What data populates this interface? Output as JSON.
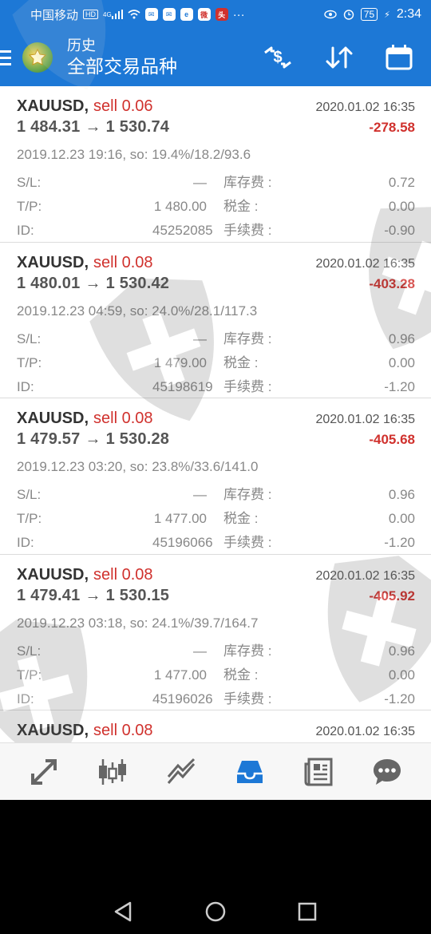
{
  "status_bar": {
    "carrier": "中国移动",
    "network": "HD",
    "signal": "4G",
    "battery": "75",
    "time": "2:34",
    "more": "···"
  },
  "app_bar": {
    "title": "历史",
    "subtitle": "全部交易品种"
  },
  "labels": {
    "sl": "S/L:",
    "tp": "T/P:",
    "id": "ID:",
    "swap": "库存费 :",
    "tax": "税金 :",
    "fee": "手续费 :",
    "arrow": "→"
  },
  "trades": [
    {
      "symbol": "XAUUSD",
      "sep": ",",
      "direction": "sell 0.06",
      "close_time": "2020.01.02 16:35",
      "open_price": "1 484.31",
      "close_price": "1 530.74",
      "profit": "-278.58",
      "open_info": "2019.12.23 19:16, so: 19.4%/18.2/93.6",
      "sl": "—",
      "tp": "1 480.00",
      "id": "45252085",
      "swap": "0.72",
      "tax": "0.00",
      "fee": "-0.90"
    },
    {
      "symbol": "XAUUSD",
      "sep": ",",
      "direction": "sell 0.08",
      "close_time": "2020.01.02 16:35",
      "open_price": "1 480.01",
      "close_price": "1 530.42",
      "profit": "-403.28",
      "open_info": "2019.12.23 04:59, so: 24.0%/28.1/117.3",
      "sl": "—",
      "tp": "1 479.00",
      "id": "45198619",
      "swap": "0.96",
      "tax": "0.00",
      "fee": "-1.20"
    },
    {
      "symbol": "XAUUSD",
      "sep": ",",
      "direction": "sell 0.08",
      "close_time": "2020.01.02 16:35",
      "open_price": "1 479.57",
      "close_price": "1 530.28",
      "profit": "-405.68",
      "open_info": "2019.12.23 03:20, so: 23.8%/33.6/141.0",
      "sl": "—",
      "tp": "1 477.00",
      "id": "45196066",
      "swap": "0.96",
      "tax": "0.00",
      "fee": "-1.20"
    },
    {
      "symbol": "XAUUSD",
      "sep": ",",
      "direction": "sell 0.08",
      "close_time": "2020.01.02 16:35",
      "open_price": "1 479.41",
      "close_price": "1 530.15",
      "profit": "-405.92",
      "open_info": "2019.12.23 03:18, so: 24.1%/39.7/164.7",
      "sl": "—",
      "tp": "1 477.00",
      "id": "45196026",
      "swap": "0.96",
      "tax": "0.00",
      "fee": "-1.20"
    },
    {
      "symbol": "XAUUSD",
      "sep": ",",
      "direction": "sell 0.08",
      "close_time": "2020.01.02 16:35"
    }
  ],
  "bottom_nav": [
    {
      "icon": "trade-arrows-icon",
      "active": false
    },
    {
      "icon": "candlestick-chart-icon",
      "active": false
    },
    {
      "icon": "trendline-icon",
      "active": false
    },
    {
      "icon": "history-inbox-icon",
      "active": true
    },
    {
      "icon": "news-icon",
      "active": false
    },
    {
      "icon": "chat-icon",
      "active": false
    }
  ],
  "colors": {
    "primary": "#1d78d6",
    "loss": "#d0312d",
    "muted": "#888888"
  }
}
